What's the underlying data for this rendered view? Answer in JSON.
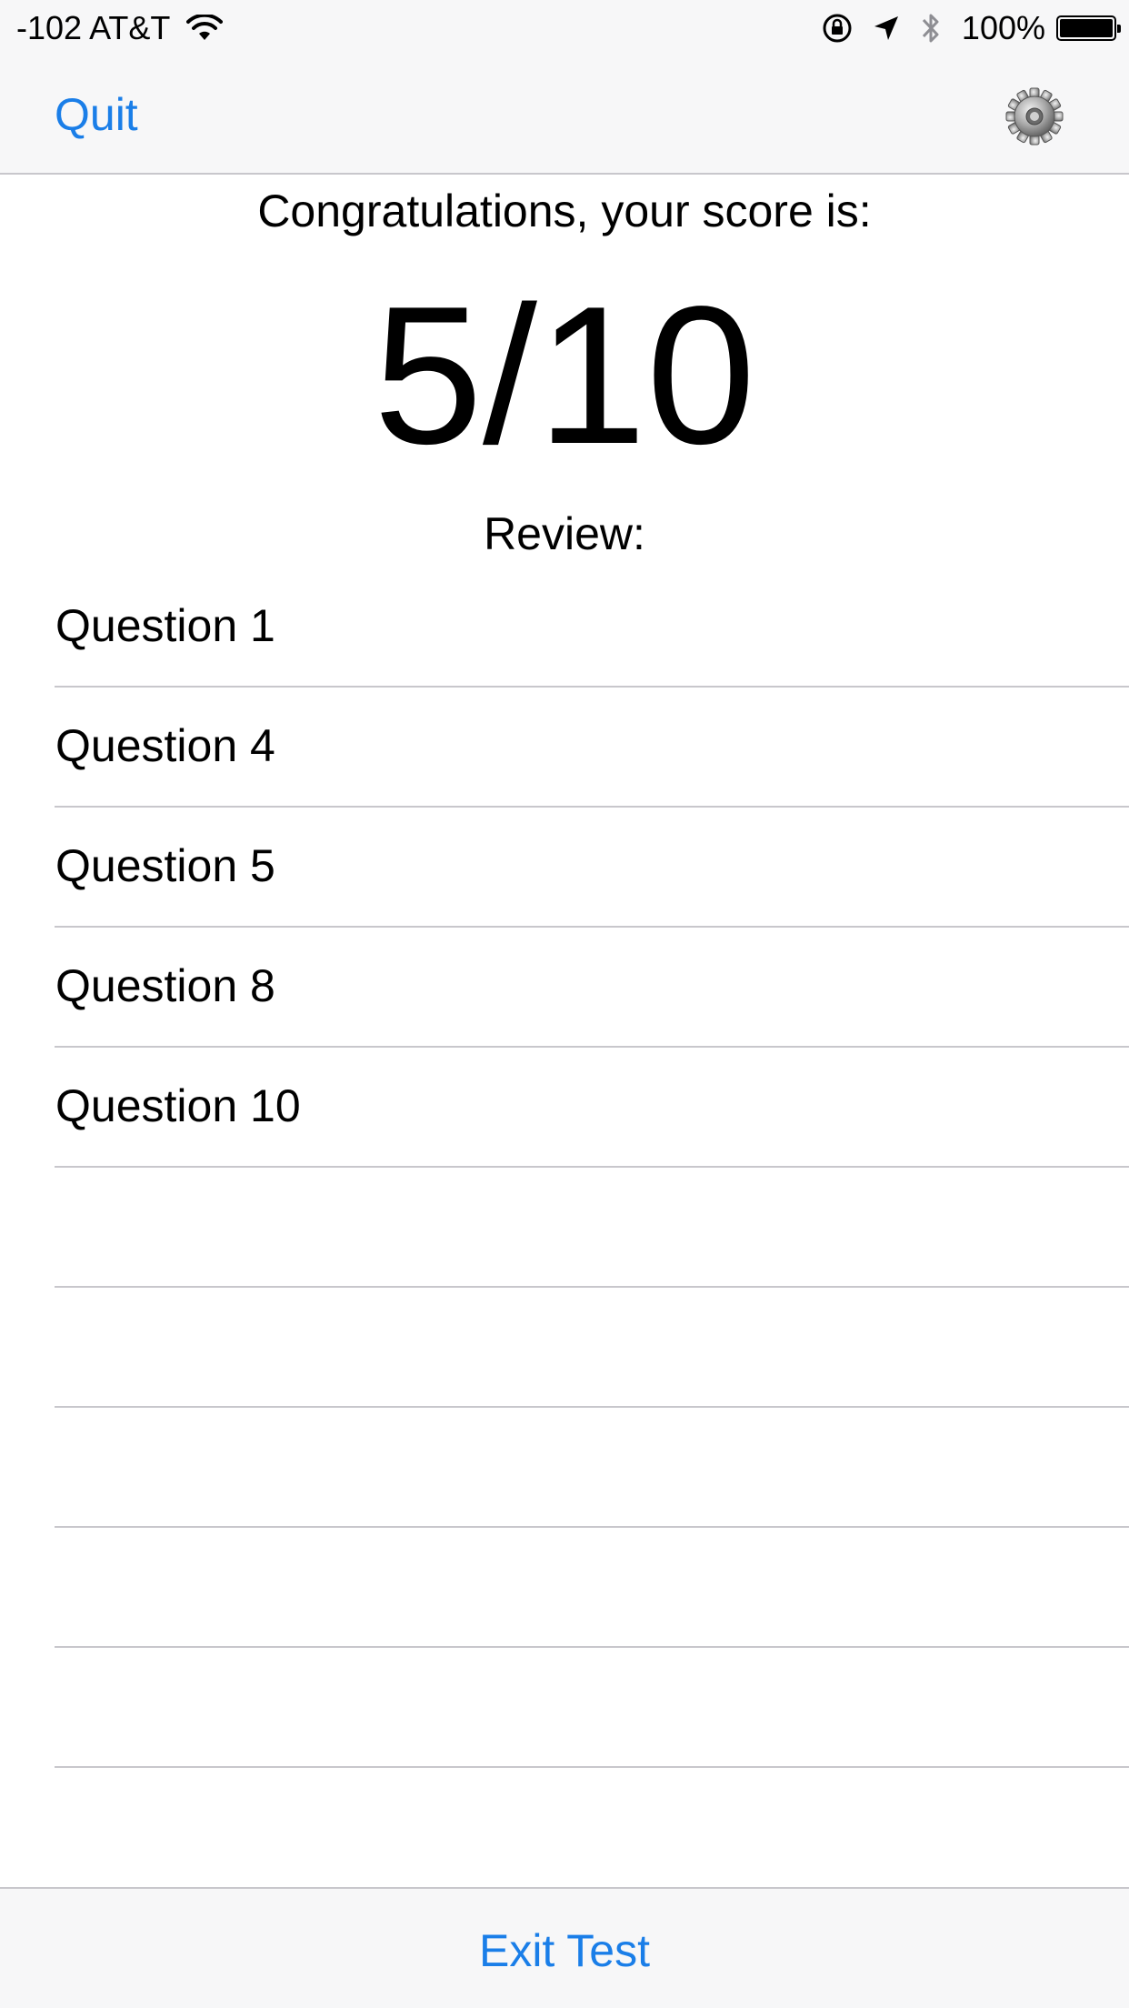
{
  "status_bar": {
    "carrier": "-102 AT&T",
    "battery_percent": "100%",
    "battery_level": 1.0,
    "icons": [
      "wifi-icon",
      "orientation-lock-icon",
      "location-arrow-icon",
      "bluetooth-icon",
      "battery-icon"
    ]
  },
  "nav": {
    "quit_label": "Quit",
    "settings_icon": "gear-icon"
  },
  "results": {
    "congrats_text": "Congratulations, your score is:",
    "score": "5/10",
    "review_label": "Review:"
  },
  "review_items": [
    {
      "label": "Question 1"
    },
    {
      "label": "Question 4"
    },
    {
      "label": "Question 5"
    },
    {
      "label": "Question 8"
    },
    {
      "label": "Question 10"
    },
    {
      "label": ""
    },
    {
      "label": ""
    },
    {
      "label": ""
    },
    {
      "label": ""
    },
    {
      "label": ""
    }
  ],
  "toolbar": {
    "exit_label": "Exit Test"
  },
  "colors": {
    "accent": "#1a7ee8",
    "bar_background": "#f7f7f8",
    "separator": "#c8c7cc"
  }
}
